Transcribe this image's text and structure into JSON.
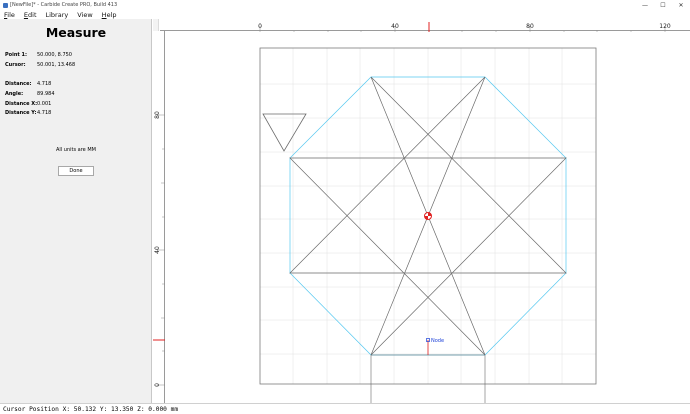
{
  "window": {
    "title": "[NewFile]* - Carbide Create PRO, Build 413",
    "minimize": "—",
    "maximize": "☐",
    "close": "✕"
  },
  "menu": {
    "items": [
      {
        "key": "F",
        "rest": "ile"
      },
      {
        "key": "E",
        "rest": "dit"
      },
      {
        "key": "",
        "rest": "Library"
      },
      {
        "key": "",
        "rest": "View"
      },
      {
        "key": "H",
        "rest": "elp"
      }
    ]
  },
  "measure_panel": {
    "title": "Measure",
    "point1_label": "Point 1:",
    "point1_value": "50.000, 8.750",
    "cursor_label": "Cursor:",
    "cursor_value": "50.001, 13.468",
    "distance_label": "Distance:",
    "distance_value": "4.718",
    "angle_label": "Angle:",
    "angle_value": "89.984",
    "distance_x_label": "Distance X:",
    "distance_x_value": "0.001",
    "distance_y_label": "Distance Y:",
    "distance_y_value": "4.718",
    "units_note": "All units are MM",
    "done_label": "Done"
  },
  "rulers": {
    "top_labels": [
      "0",
      "40",
      "80",
      "120"
    ],
    "left_labels": [
      "80",
      "40",
      "0"
    ],
    "marker_color": "#e02020"
  },
  "canvas": {
    "node_label": "Node",
    "colors": {
      "stock_border": "#7a7a7a",
      "grid": "#e0e0e0",
      "star": "#6a6a6a",
      "octagon": "#55c8f0",
      "node": "#1a3fd8",
      "origin_red": "#e02020"
    }
  },
  "status_bar": {
    "text": "Cursor Position X: 50.132 Y: 13.350 Z: 0.000 mm"
  }
}
